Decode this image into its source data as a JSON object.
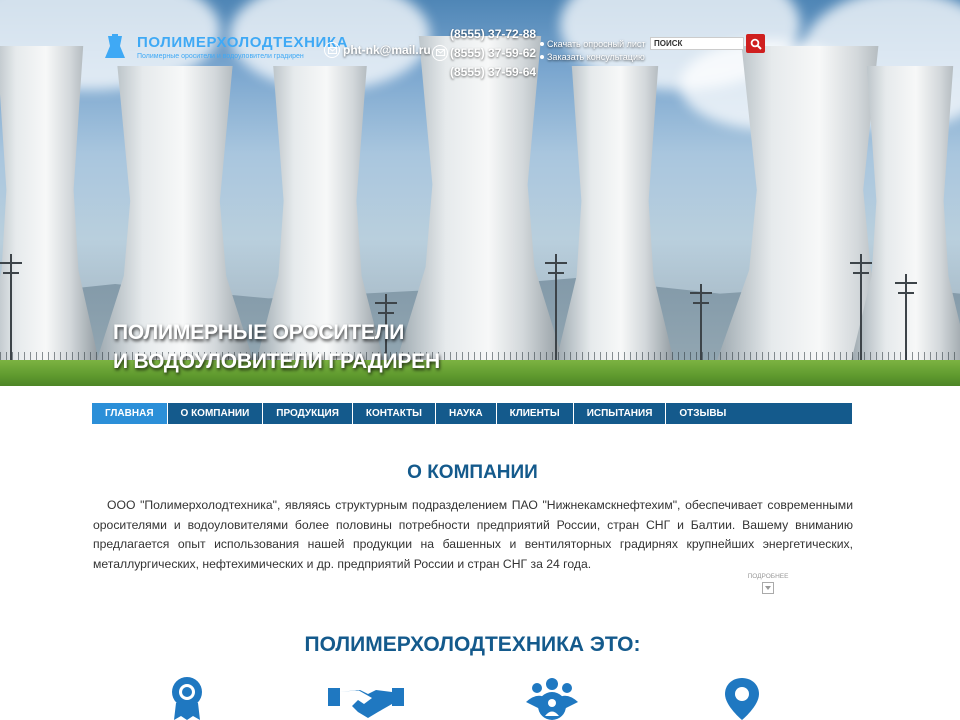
{
  "header": {
    "logo_name": "Полимерхолодтехника",
    "logo_sub": "Полимерные оросители и водоуловители градирен",
    "email": "pht-nk@mail.ru",
    "phones": [
      "(8555) 37-72-88",
      "(8555) 37-59-62",
      "(8555) 37-59-64"
    ],
    "links": [
      "Скачать опросный лист",
      "Заказать консультацию"
    ],
    "search_placeholder": "ПОИСК"
  },
  "hero": {
    "title_line1": "Полимерные оросители",
    "title_line2": "и водоуловители градирен"
  },
  "nav": {
    "items": [
      "Главная",
      "О компании",
      "Продукция",
      "Контакты",
      "Наука",
      "Клиенты",
      "Испытания",
      "Отзывы"
    ],
    "active": "Главная"
  },
  "about": {
    "title": "О компании",
    "text": "ООО \"Полимерхолодтехника\", являясь структурным подразделением ПАО \"Нижнекамскнефтехим\", обеспечивает современными оросителями и водоуловителями более половины потребности предприятий России, стран СНГ и Балтии. Вашему вниманию предлагается опыт использования нашей продукции на башенных и вентиляторных градирнях крупнейших энергетических, металлургических, нефтехимических и др. предприятий России и стран СНГ за 24 года.",
    "more": "Подробнее"
  },
  "features": {
    "title": "Полимерхолодтехника это:",
    "icons": [
      "award-icon",
      "handshake-icon",
      "team-icon",
      "location-pin-icon"
    ]
  },
  "colors": {
    "brand": "#145a8c",
    "nav_active": "#2b8fd8",
    "logo": "#3fa9f5",
    "search_button": "#cf1f1f"
  }
}
